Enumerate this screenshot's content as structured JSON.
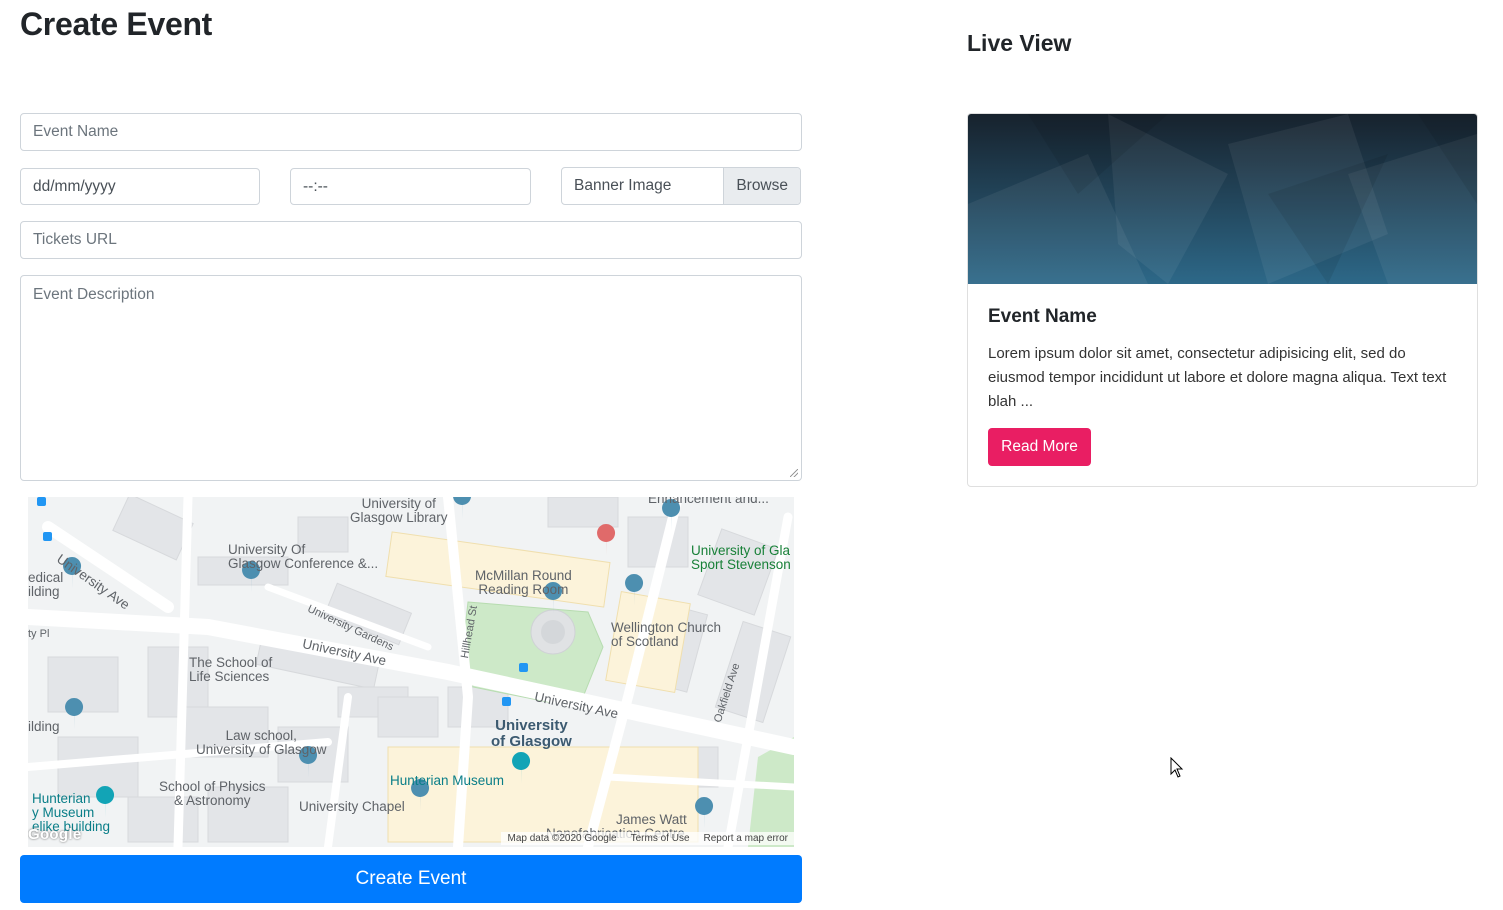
{
  "form": {
    "title": "Create Event",
    "event_name_placeholder": "Event Name",
    "date_placeholder": "dd/mm/yyyy",
    "time_placeholder": "--:--",
    "banner_label": "Banner Image",
    "browse_label": "Browse",
    "tickets_url_placeholder": "Tickets URL",
    "description_placeholder": "Event Description",
    "submit_label": "Create Event"
  },
  "map": {
    "labels": {
      "university_library": "University of\nGlasgow Library",
      "enhancement": "Enhancement and...",
      "conference": "University Of\nGlasgow Conference &...",
      "medical_building": "edical\nilding",
      "university_ave_1": "University Ave",
      "university_pl": "ty Pl",
      "mcmillan": "McMillan Round\nReading Room",
      "sport": "University of Gla\nSport Stevenson bui",
      "university_gardens": "University Gardens",
      "hillhead_st": "Hillhead St",
      "wellington": "Wellington Church\nof Scotland",
      "university_ave_2": "University Ave",
      "life_sciences": "The School of\nLife Sciences",
      "oakfield_ave": "Oakfield Ave",
      "building": "ilding",
      "university_ave_3": "University Ave",
      "university_of_glasgow": "University\nof Glasgow",
      "law_school": "Law school,\nUniversity of Glasgow",
      "hunterian_museum": "Hunterian Museum",
      "physics": "School of Physics\n& Astronomy",
      "hunterian_left": "Hunterian\ny Museum\nelike building",
      "chapel": "University Chapel",
      "james_watt": "James Watt",
      "nanofab": "Nanofabrication Centre"
    },
    "footer": {
      "map_data": "Map data ©2020 Google",
      "terms": "Terms of Use",
      "report": "Report a map error"
    },
    "logo": "Google"
  },
  "preview": {
    "title": "Live View",
    "card_title": "Event Name",
    "card_text": "Lorem ipsum dolor sit amet, consectetur adipisicing elit, sed do eiusmod tempor incididunt ut labore et dolore magna aliqua. Text text blah ...",
    "read_more_label": "Read More"
  },
  "colors": {
    "primary": "#007bff",
    "accent": "#e91e63",
    "banner_dark": "#1a2a38",
    "banner_light": "#2f6a8c"
  }
}
